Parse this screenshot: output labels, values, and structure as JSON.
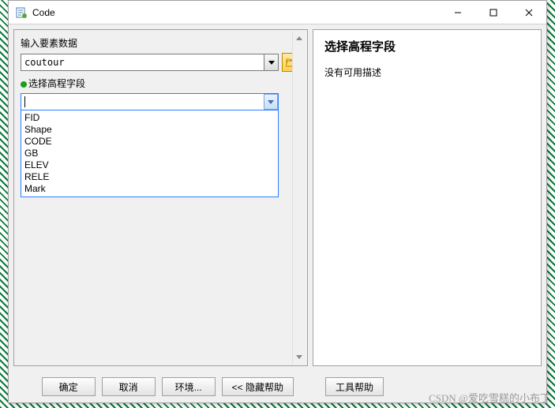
{
  "window": {
    "title": "Code"
  },
  "left": {
    "input_label": "输入要素数据",
    "input_value": "coutour",
    "field_label": "选择高程字段",
    "dropdown_options": [
      "FID",
      "Shape",
      "CODE",
      "GB",
      "ELEV",
      "RELE",
      "Mark"
    ]
  },
  "right": {
    "title": "选择高程字段",
    "body": "没有可用描述"
  },
  "buttons": {
    "ok": "确定",
    "cancel": "取消",
    "env": "环境...",
    "hide_help": "<< 隐藏帮助",
    "tool_help": "工具帮助"
  },
  "watermark": "CSDN @爱吃雪糕的小布丁"
}
